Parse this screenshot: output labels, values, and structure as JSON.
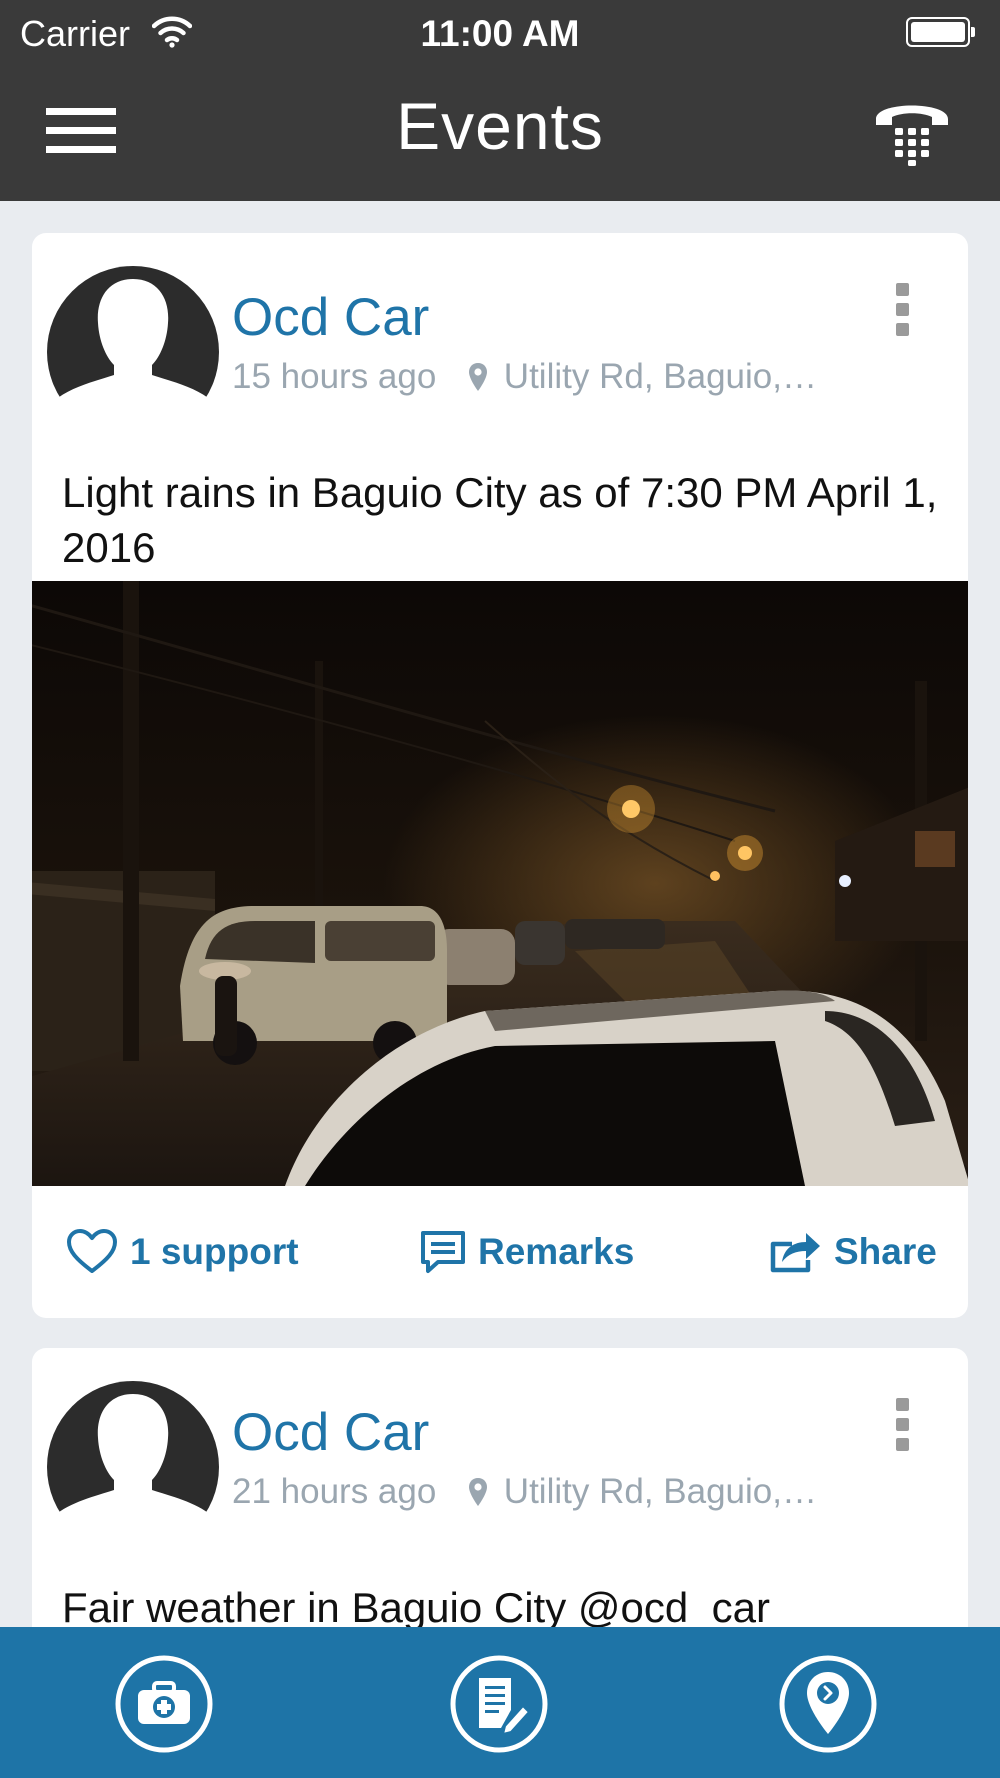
{
  "status_bar": {
    "carrier": "Carrier",
    "time": "11:00 AM"
  },
  "nav": {
    "title": "Events"
  },
  "posts": [
    {
      "author": "Ocd Car",
      "time_ago": "15 hours ago",
      "location": "Utility Rd, Baguio,…",
      "text": "Light rains in Baguio City as of 7:30 PM April 1, 2016",
      "actions": {
        "support": "1 support",
        "remarks": "Remarks",
        "share": "Share"
      }
    },
    {
      "author": "Ocd Car",
      "time_ago": "21 hours ago",
      "location": "Utility Rd, Baguio,…",
      "text": "Fair weather in Baguio City @ocd_car"
    }
  ],
  "tabs": [
    {
      "icon": "first-aid-kit-icon"
    },
    {
      "icon": "report-edit-icon"
    },
    {
      "icon": "location-pin-icon"
    }
  ],
  "colors": {
    "nav_bg": "#3a3a3a",
    "accent": "#1f74a8",
    "tabbar_bg": "#1e74a7",
    "page_bg": "#e9ecf0"
  }
}
